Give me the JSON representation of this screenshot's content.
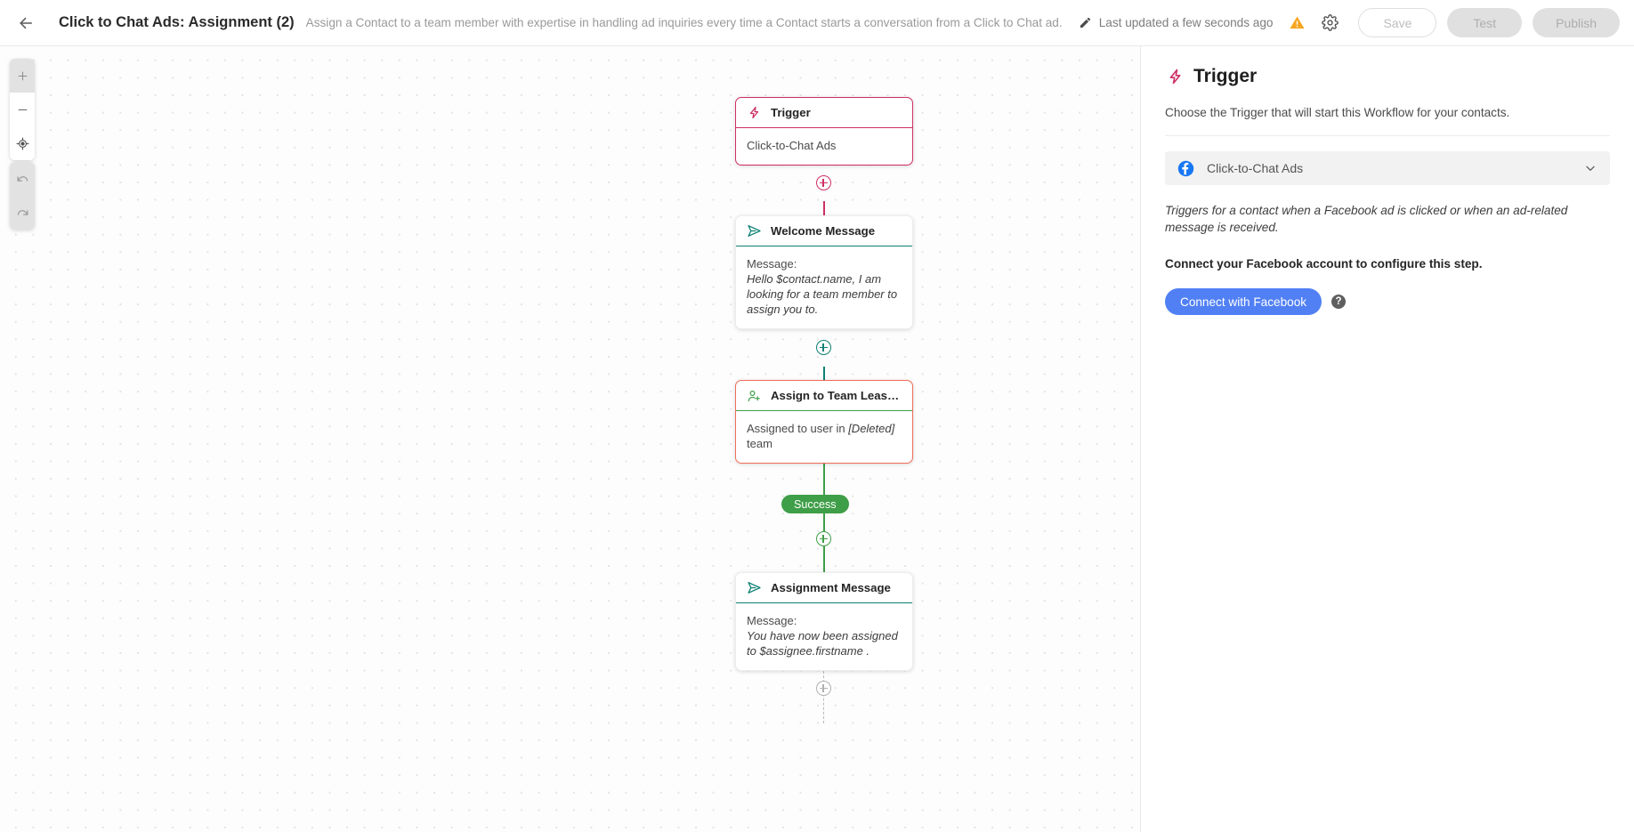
{
  "header": {
    "back_icon": "arrow-left-icon",
    "title": "Click to Chat Ads: Assignment (2)",
    "description": "Assign a Contact to a team member with expertise in handling ad inquiries every time a Contact starts a conversation from a Click to Chat ad.",
    "edit_icon": "pencil-icon",
    "last_updated": "Last updated a few seconds ago",
    "warning_icon": "warning-triangle-icon",
    "settings_icon": "gear-icon",
    "save_label": "Save",
    "test_label": "Test",
    "publish_label": "Publish",
    "warning_color": "#f5a623"
  },
  "canvas": {
    "controls": {
      "zoom_in_icon": "plus-icon",
      "zoom_out_icon": "minus-icon",
      "recenter_icon": "crosshair-target-icon",
      "undo_icon": "undo-arrow-icon",
      "redo_icon": "redo-arrow-icon"
    },
    "nodes": [
      {
        "name": "trigger",
        "icon": "lightning-bolt-icon",
        "title": "Trigger",
        "body_text": "Click-to-Chat Ads",
        "accent": "#cf2f63",
        "state": "selected"
      },
      {
        "name": "welcome-message",
        "icon": "send-message-icon",
        "title": "Welcome Message",
        "body_label": "Message:",
        "body_message": "Hello $contact.name, I am looking for a team member to assign you to.",
        "accent": "#0d8074",
        "state": "normal"
      },
      {
        "name": "assign-to-team-least-conversations",
        "icon": "assign-user-icon",
        "title": "Assign to Team Least C...",
        "body_prefix": "Assigned to user in ",
        "body_emphasis": "[Deleted]",
        "body_suffix": " team",
        "accent": "#3f9e48",
        "state": "error",
        "error_color": "#ef6c5a"
      },
      {
        "name": "assignment-message",
        "icon": "send-message-icon",
        "title": "Assignment Message",
        "body_label": "Message:",
        "body_message": "You have now been assigned to $assignee.firstname .",
        "accent": "#0d8074",
        "state": "normal"
      }
    ],
    "success_badge": "Success",
    "add_step_icon": "plus-circle-icon"
  },
  "panel": {
    "bolt_icon": "lightning-bolt-icon",
    "title": "Trigger",
    "subtitle": "Choose the Trigger that will start this Workflow for your contacts.",
    "select_icon": "facebook-icon",
    "select_value": "Click-to-Chat Ads",
    "chevron_icon": "chevron-down-icon",
    "note": "Triggers for a contact when a Facebook ad is clicked or when an ad-related message is received.",
    "connect_label": "Connect your Facebook account to configure this step.",
    "connect_button": "Connect with Facebook",
    "help_label": "?",
    "facebook_blue": "#1877F2",
    "button_blue": "#5180f4"
  }
}
